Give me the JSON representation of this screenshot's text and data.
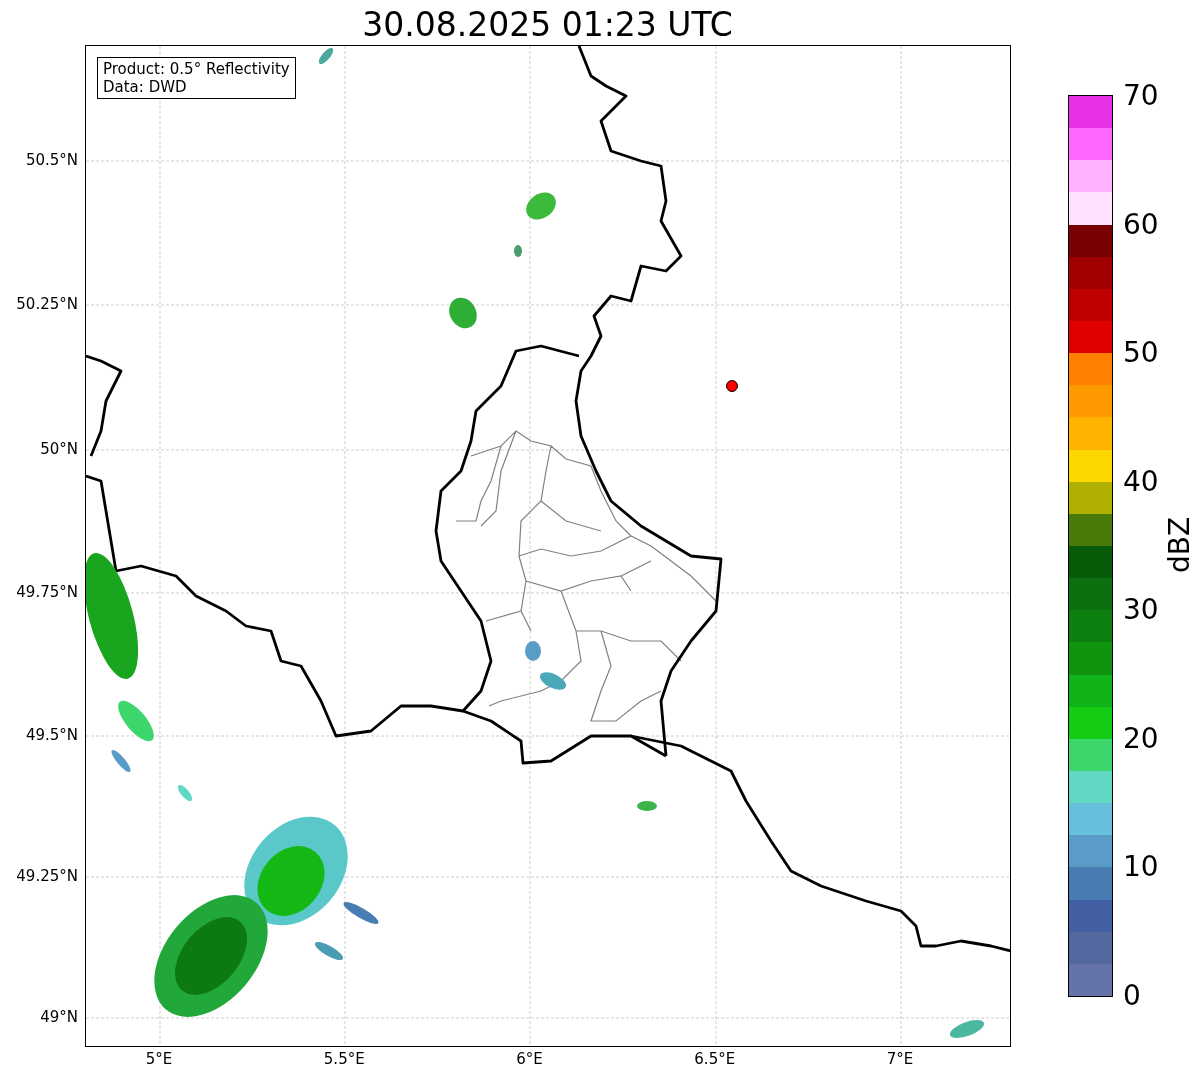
{
  "title": "30.08.2025 01:23 UTC",
  "info_box": {
    "lines": [
      "Product: 0.5° Reflectivity",
      "Data: DWD"
    ]
  },
  "map": {
    "lat_ticks": [
      "50.5°N",
      "50.25°N",
      "50°N",
      "49.75°N",
      "49.5°N",
      "49.25°N",
      "49°N"
    ],
    "lon_ticks": [
      "5°E",
      "5.5°E",
      "6°E",
      "6.5°E",
      "7°E"
    ]
  },
  "colorbar": {
    "label": "dBZ",
    "ticks": [
      "70",
      "60",
      "50",
      "40",
      "30",
      "20",
      "10",
      "0"
    ],
    "bands": [
      {
        "color": "#e832e8"
      },
      {
        "color": "#ff66ff"
      },
      {
        "color": "#ffb3ff"
      },
      {
        "color": "#ffe0ff"
      },
      {
        "color": "#780000"
      },
      {
        "color": "#a00000"
      },
      {
        "color": "#c00000"
      },
      {
        "color": "#e00000"
      },
      {
        "color": "#ff8000"
      },
      {
        "color": "#ff9900"
      },
      {
        "color": "#ffb300"
      },
      {
        "color": "#ffd700"
      },
      {
        "color": "#b0b000"
      },
      {
        "color": "#4a7a0a"
      },
      {
        "color": "#065c08"
      },
      {
        "color": "#0c7010"
      },
      {
        "color": "#0e8010"
      },
      {
        "color": "#109410"
      },
      {
        "color": "#10b418"
      },
      {
        "color": "#14cc14"
      },
      {
        "color": "#3cd66c"
      },
      {
        "color": "#60d8c4"
      },
      {
        "color": "#66c0dc"
      },
      {
        "color": "#5a9cc8"
      },
      {
        "color": "#4a7cb4"
      },
      {
        "color": "#4460a4"
      },
      {
        "color": "#5468a0"
      },
      {
        "color": "#6474a8"
      }
    ]
  }
}
